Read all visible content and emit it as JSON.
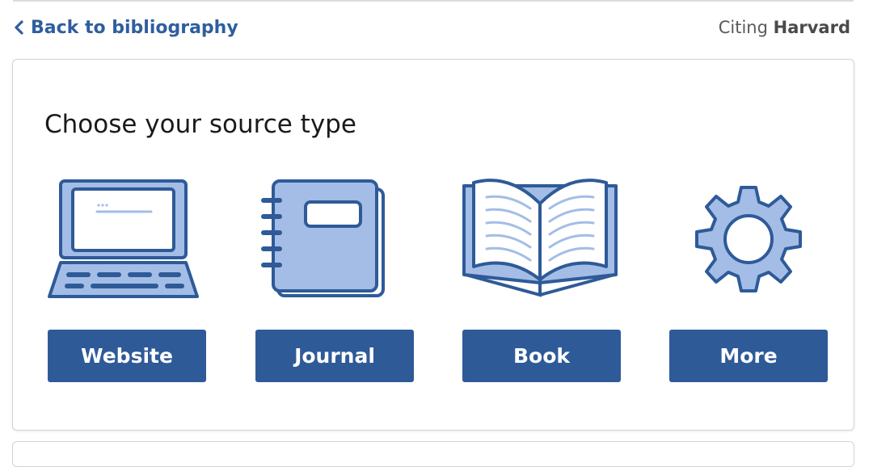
{
  "nav": {
    "back_label": "Back to bibliography",
    "citing_prefix": "Citing",
    "citing_style": "Harvard"
  },
  "card": {
    "title": "Choose your source type"
  },
  "sources": [
    {
      "label": "Website",
      "icon": "laptop-icon"
    },
    {
      "label": "Journal",
      "icon": "notebook-icon"
    },
    {
      "label": "Book",
      "icon": "open-book-icon"
    },
    {
      "label": "More",
      "icon": "gear-icon"
    }
  ],
  "colors": {
    "primary": "#2e5a98",
    "icon_fill": "#a3bde6",
    "icon_stroke": "#2e5a98",
    "link": "#2f5e9e"
  }
}
